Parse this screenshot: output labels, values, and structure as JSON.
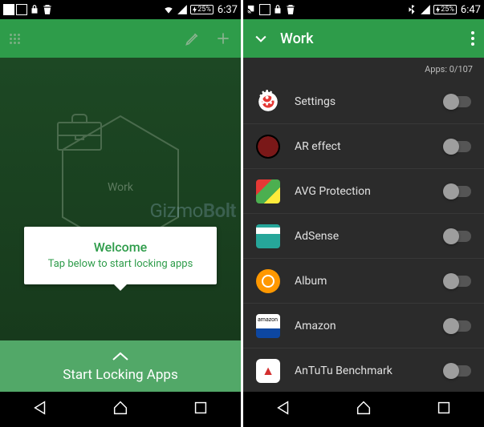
{
  "left": {
    "statusbar": {
      "battery": "25%",
      "time": "6:37"
    },
    "hex_label": "Work",
    "welcome": {
      "title": "Welcome",
      "subtitle": "Tap below to start locking apps"
    },
    "start_label": "Start Locking Apps"
  },
  "right": {
    "statusbar": {
      "battery": "25%",
      "time": "6:47"
    },
    "toolbar_title": "Work",
    "apps_count": "Apps: 0/107",
    "apps": [
      {
        "name": "Settings"
      },
      {
        "name": "AR effect"
      },
      {
        "name": "AVG Protection"
      },
      {
        "name": "AdSense"
      },
      {
        "name": "Album"
      },
      {
        "name": "Amazon"
      },
      {
        "name": "AnTuTu Benchmark"
      }
    ]
  },
  "watermark": "GizmoBolt"
}
